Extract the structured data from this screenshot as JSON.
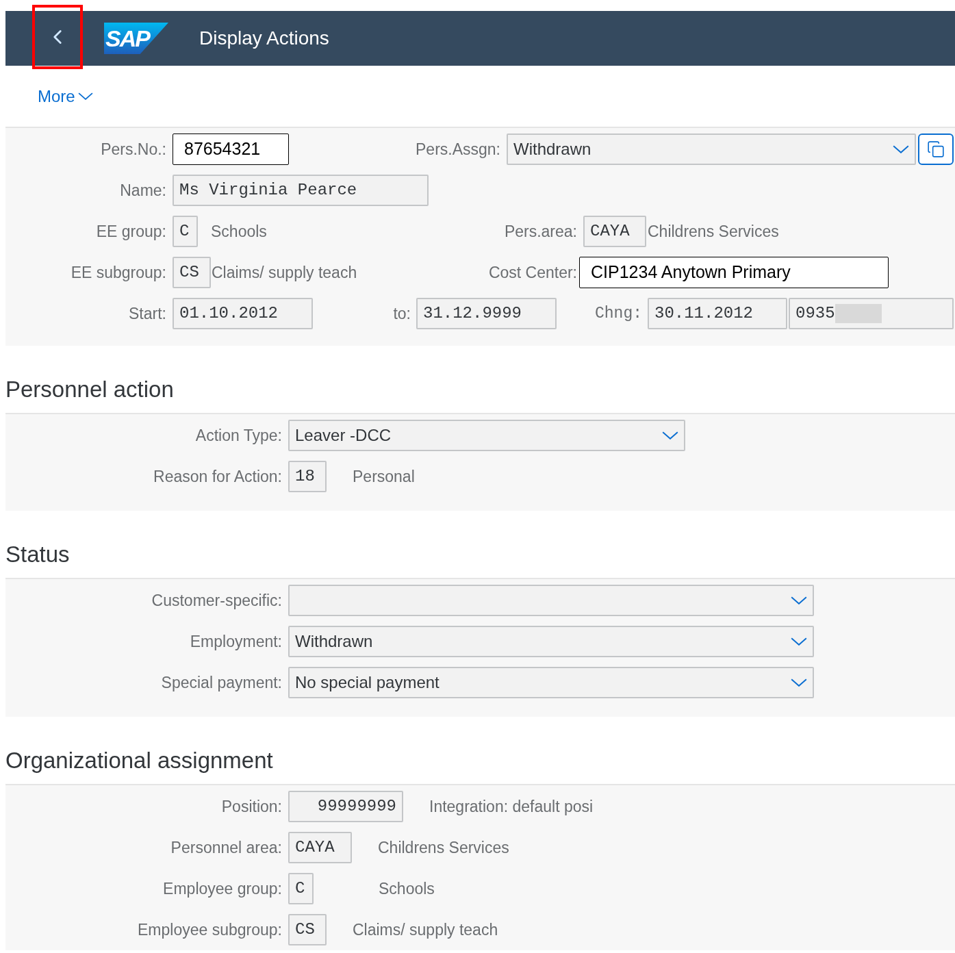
{
  "header": {
    "logo": "SAP",
    "title": "Display Actions"
  },
  "toolbar": {
    "more": "More"
  },
  "employee": {
    "pers_no": {
      "label": "Pers.No.:",
      "value": "87654321"
    },
    "pers_assgn": {
      "label": "Pers.Assgn:",
      "value": "Withdrawn"
    },
    "name": {
      "label": "Name:",
      "value": "Ms Virginia Pearce"
    },
    "ee_group": {
      "label": "EE group:",
      "code": "C",
      "text": "Schools"
    },
    "pers_area": {
      "label": "Pers.area:",
      "code": "CAYA",
      "text": "Childrens Services"
    },
    "ee_subgroup": {
      "label": "EE subgroup:",
      "code": "CS",
      "text": "Claims/ supply teach"
    },
    "cost_center": {
      "label": "Cost Center:",
      "value": "CIP1234 Anytown Primary"
    },
    "start": {
      "label": "Start:",
      "value": "01.10.2012"
    },
    "to": {
      "label": "to:",
      "value": "31.12.9999"
    },
    "chng": {
      "label": "Chng:",
      "date": "30.11.2012",
      "time": "0935"
    }
  },
  "sections": [
    {
      "title": "Personnel action",
      "rows": [
        {
          "kind": "select",
          "label": "Action Type:",
          "value": "Leaver -DCC"
        },
        {
          "kind": "code",
          "label": "Reason for Action:",
          "value": "18",
          "text": "Personal"
        }
      ]
    },
    {
      "title": "Status",
      "rows": [
        {
          "kind": "dropdown",
          "label": "Customer-specific:"
        },
        {
          "kind": "dropdown",
          "label": "Employment:",
          "value": "Withdrawn"
        },
        {
          "kind": "dropdown",
          "label": "Special payment:",
          "value": "No special payment"
        }
      ]
    },
    {
      "title": "Organizational assignment",
      "rows": [
        {
          "kind": "code",
          "label": "Position:",
          "value": "99999999",
          "text": "Integration: default posi"
        },
        {
          "kind": "code",
          "label": "Personnel area:",
          "value": "CAYA",
          "text": "Childrens Services"
        },
        {
          "kind": "code",
          "label": "Employee group:",
          "value": "C",
          "text": "Schools"
        },
        {
          "kind": "code",
          "label": "Employee subgroup:",
          "value": "CS",
          "text": "Claims/ supply teach"
        }
      ]
    }
  ]
}
